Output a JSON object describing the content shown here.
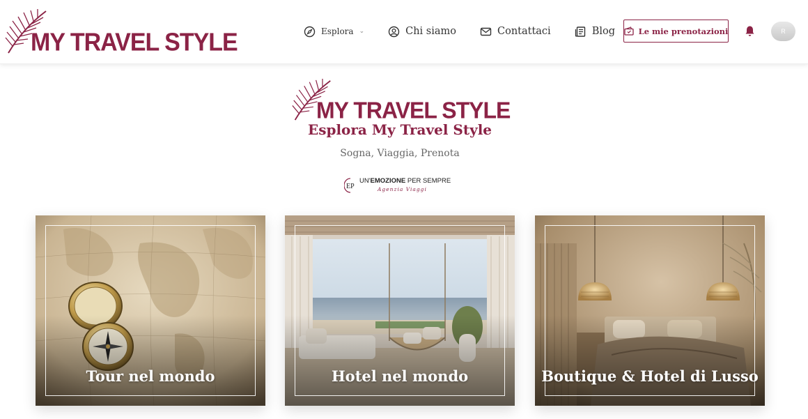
{
  "brand": {
    "name": "MY TRAVEL STYLE",
    "color": "#8b2346"
  },
  "nav": {
    "explore_label": "Esplora",
    "about_label": "Chi siamo",
    "contact_label": "Contattaci",
    "blog_label": "Blog",
    "bookings_label": "Le mie prenotazioni",
    "avatar_initial": "R"
  },
  "hero": {
    "title": "Esplora My Travel Style",
    "subtitle": "Sogna, Viaggia, Prenota",
    "partner_line1_a": "UN'",
    "partner_line1_b": "EMOZIONE",
    "partner_line1_c": " PER SEMPRE",
    "partner_line2": "Agenzia Viaggi",
    "partner_mark": "EP"
  },
  "cards": [
    {
      "title": "Tour nel mondo"
    },
    {
      "title": "Hotel nel mondo"
    },
    {
      "title": "Boutique & Hotel di Lusso"
    }
  ],
  "icons": [
    "palm-leaf-icon",
    "compass-icon",
    "user-circle-icon",
    "mail-icon",
    "news-icon",
    "ticket-icon",
    "bell-icon",
    "chevron-down-icon"
  ]
}
